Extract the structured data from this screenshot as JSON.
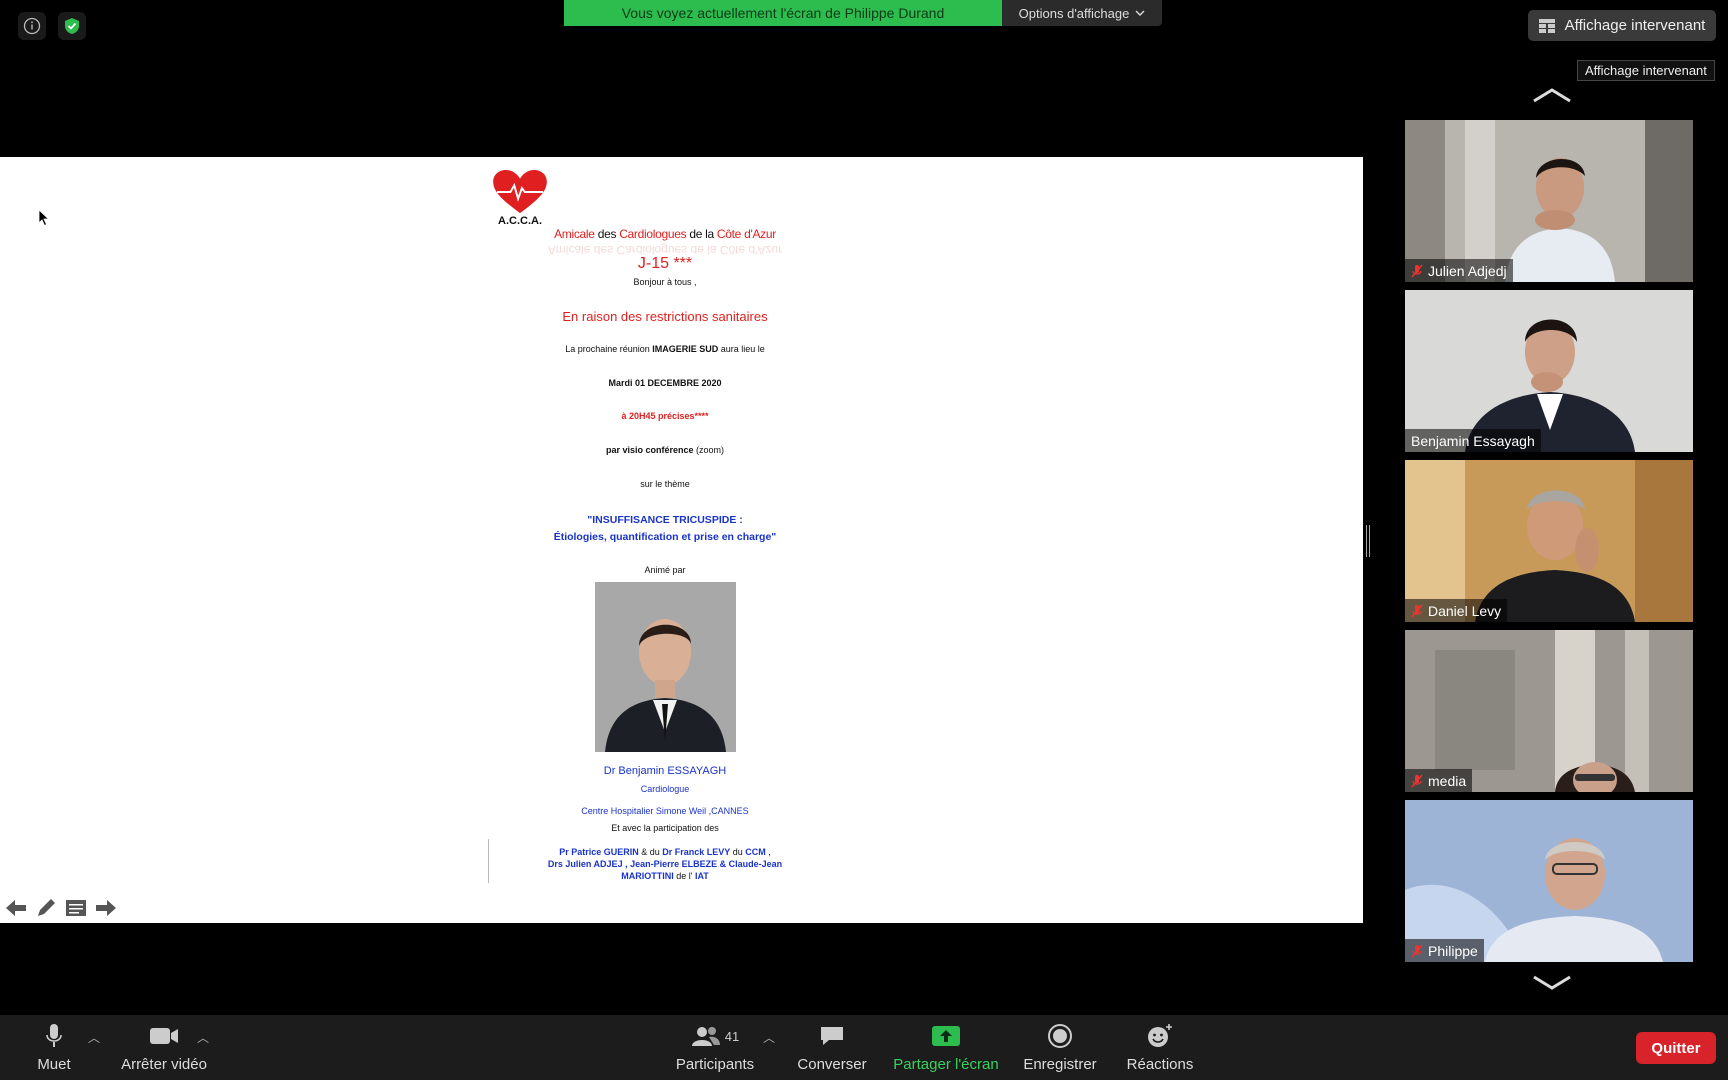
{
  "top": {
    "banner": "Vous voyez actuellement l'écran de Philippe Durand",
    "view_options": "Options d'affichage",
    "speaker_view": "Affichage intervenant",
    "tooltip": "Affichage intervenant"
  },
  "doc": {
    "acca": "A.C.C.A.",
    "org": {
      "a": "Amicale",
      "b": " des ",
      "c": "Cardiologues",
      "d": " de la ",
      "e": "Côte d'Azur"
    },
    "mirror": "Amicale des Cardiologues de la Côte d'Azur",
    "countdown": "J-15 ***",
    "greeting": "Bonjour à tous ,",
    "restriction": "En raison des restrictions sanitaires",
    "meeting": {
      "pre": "La prochaine réunion ",
      "name": "IMAGERIE SUD",
      "post": " aura lieu le"
    },
    "date": "Mardi 01 DECEMBRE  2020",
    "time": "à  20H45 précises****",
    "visio": {
      "bold": "par visio conférence",
      "rest": " (zoom)"
    },
    "theme_label": "sur le thème",
    "theme1": "\"INSUFFISANCE TRICUSPIDE :",
    "theme2": "Étiologies, quantification et prise en charge\"",
    "animated": "Animé par",
    "doctor": "Dr Benjamin ESSAYAGH",
    "role": "Cardiologue",
    "hospital": "Centre Hospitalier Simone Weil ,CANNES",
    "with": "Et avec la participation des",
    "p1": {
      "a": "Pr Patrice GUERIN",
      "b": " & du ",
      "c": "Dr Franck LEVY",
      "d": " du ",
      "e": "CCM",
      "f": " ,"
    },
    "p2": "Drs Julien ADJEJ , Jean-Pierre ELBEZE & Claude-Jean",
    "p3": {
      "a": "MARIOTTINI",
      "b": " de l' ",
      "c": "IAT"
    }
  },
  "participants": [
    {
      "name": "Julien Adjedj",
      "muted": true
    },
    {
      "name": "Benjamin Essayagh",
      "muted": false
    },
    {
      "name": "Daniel Levy",
      "muted": true
    },
    {
      "name": "media",
      "muted": true
    },
    {
      "name": "Philippe",
      "muted": true
    }
  ],
  "toolbar": {
    "mute": "Muet",
    "video": "Arrêter vidéo",
    "participants": "Participants",
    "participant_count": "41",
    "chat": "Converser",
    "share": "Partager l'écran",
    "record": "Enregistrer",
    "reactions": "Réactions",
    "quit": "Quitter"
  },
  "colors": {
    "accent_green": "#2dbd4f",
    "quit_red": "#d8232a",
    "doc_red": "#e02020",
    "doc_blue": "#1a33c8"
  }
}
